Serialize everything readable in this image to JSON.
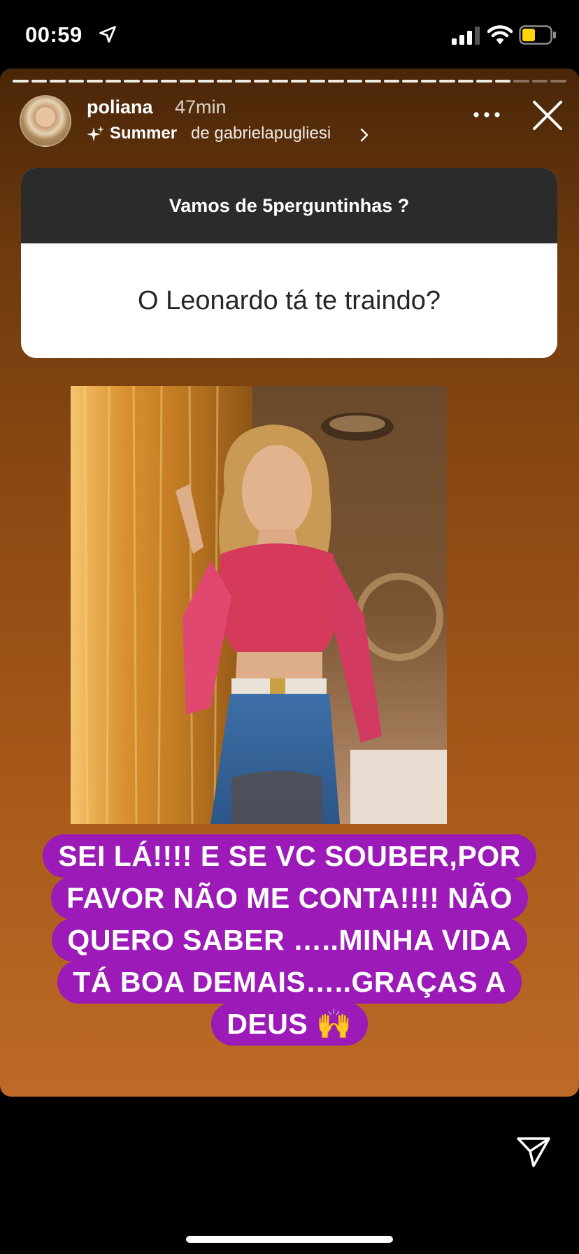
{
  "status_bar": {
    "time": "00:59",
    "battery_color": "#ffd60a"
  },
  "story": {
    "username": "poliana",
    "time_ago": "47min",
    "music": {
      "title": "Summer",
      "artist_text": "de gabrielapugliesi"
    },
    "progress_segments_done": 27,
    "progress_segments_total": 30,
    "question_sticker": {
      "header": "Vamos de 5perguntinhas ?",
      "question": "O Leonardo tá te traindo?"
    },
    "caption_lines": [
      "SEI LÁ!!!! E SE VC SOUBER,POR",
      "FAVOR NÃO ME CONTA!!!!  NÃO",
      "QUERO SABER …..MINHA VIDA",
      "TÁ BOA  DEMAIS…..GRAÇAS A",
      "DEUS 🙌"
    ],
    "colors": {
      "caption_bg": "#9b1ab8",
      "question_header_bg": "#2b2b2b"
    }
  },
  "icons": [
    "location-arrow-icon",
    "signal-icon",
    "wifi-icon",
    "battery-icon",
    "sparkle-icon",
    "chevron-right-icon",
    "more-icon",
    "close-icon",
    "send-icon"
  ]
}
